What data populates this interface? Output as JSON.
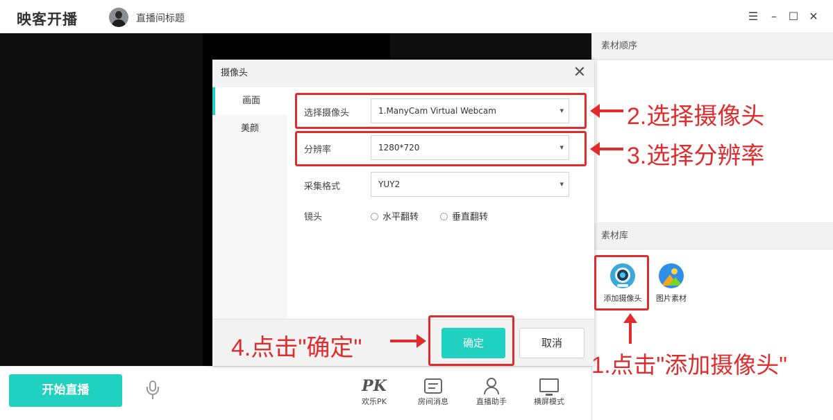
{
  "app": {
    "title": "映客开播",
    "stream_title": "直播间标题",
    "window_controls": {
      "menu": "☰",
      "minimize": "–",
      "maximize": "☐",
      "close": "✕"
    }
  },
  "right_panel": {
    "sort_header": "素材顺序",
    "library_header": "素材库",
    "library_items": [
      {
        "label": "添加摄像头",
        "icon": "camera-icon"
      },
      {
        "label": "图片素材",
        "icon": "image-icon"
      }
    ]
  },
  "bottom_bar": {
    "start_label": "开始直播",
    "tools": [
      {
        "label": "欢乐PK",
        "glyph": "PK",
        "icon": "pk-icon"
      },
      {
        "label": "房间消息",
        "icon": "message-icon"
      },
      {
        "label": "直播助手",
        "icon": "assistant-icon"
      },
      {
        "label": "横屏模式",
        "icon": "landscape-icon"
      }
    ]
  },
  "dialog": {
    "title": "摄像头",
    "close_glyph": "✕",
    "tabs": [
      {
        "label": "画面",
        "active": true
      },
      {
        "label": "美颜",
        "active": false
      }
    ],
    "fields": {
      "camera": {
        "label": "选择摄像头",
        "value": "1.ManyCam Virtual Webcam"
      },
      "resolution": {
        "label": "分辨率",
        "value": "1280*720"
      },
      "format": {
        "label": "采集格式",
        "value": "YUY2"
      },
      "mirror": {
        "label": "镜头",
        "options": [
          "水平翻转",
          "垂直翻转"
        ]
      }
    },
    "ok_label": "确定",
    "cancel_label": "取消"
  },
  "annotations": {
    "step1": "1.点击\"添加摄像头\"",
    "step2": "2.选择摄像头",
    "step3": "3.选择分辨率",
    "step4": "4.点击\"确定\"",
    "color": "#e02c2c"
  },
  "colors": {
    "accent": "#21d2c0"
  }
}
